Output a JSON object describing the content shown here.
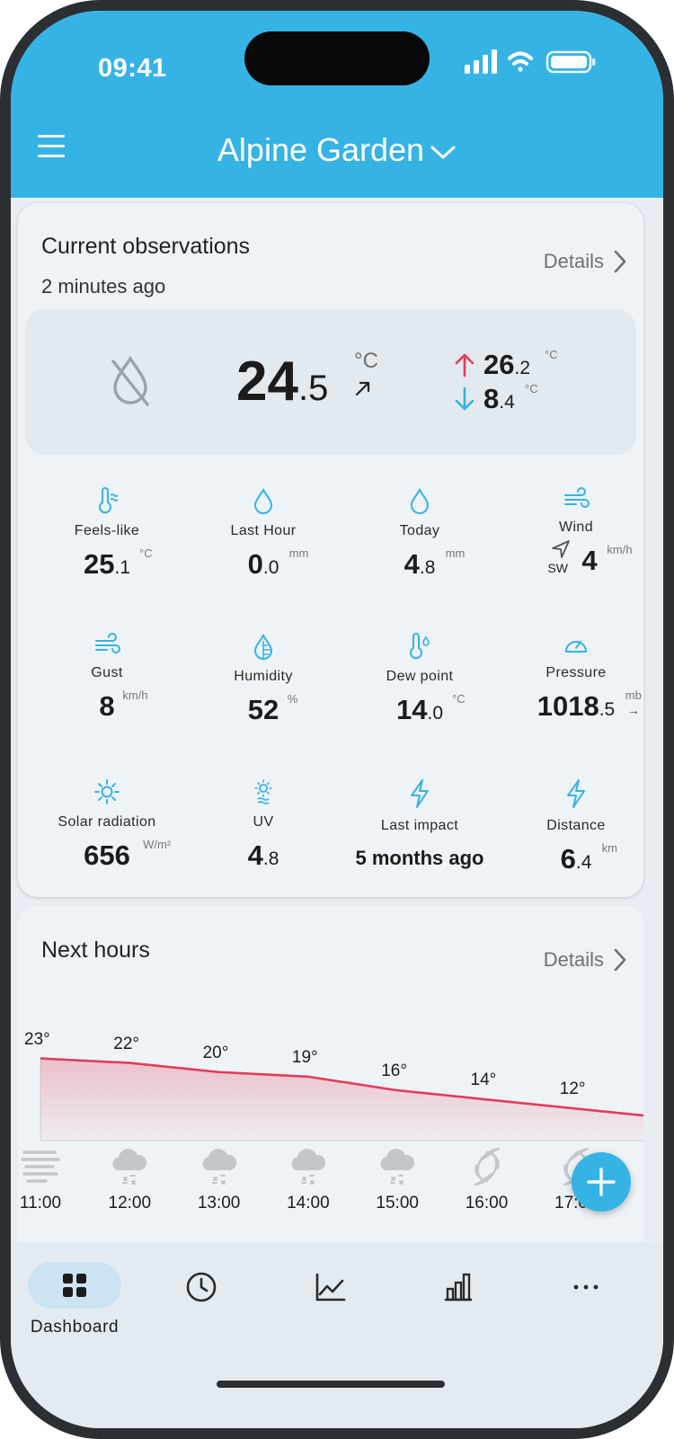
{
  "status_bar": {
    "time": "09:41"
  },
  "header": {
    "station_name": "Alpine Garden"
  },
  "current": {
    "title": "Current observations",
    "updated": "2 minutes ago",
    "details_label": "Details",
    "temperature": {
      "whole": "24",
      "decimal": ".5",
      "unit": "°C",
      "trend": "rising"
    },
    "high": {
      "whole": "26",
      "decimal": ".2",
      "unit": "°C"
    },
    "low": {
      "whole": "8",
      "decimal": ".4",
      "unit": "°C"
    },
    "metrics": [
      {
        "label": "Feels-like",
        "whole": "25",
        "decimal": ".1",
        "unit": "°C",
        "icon": "thermometer-wind-icon"
      },
      {
        "label": "Last Hour",
        "whole": "0",
        "decimal": ".0",
        "unit": "mm",
        "icon": "raindrop-icon"
      },
      {
        "label": "Today",
        "whole": "4",
        "decimal": ".8",
        "unit": "mm",
        "icon": "raindrop-icon"
      },
      {
        "label": "Wind",
        "whole": "4",
        "decimal": "",
        "unit": "km/h",
        "direction": "SW",
        "icon": "wind-icon"
      },
      {
        "label": "Gust",
        "whole": "8",
        "decimal": "",
        "unit": "km/h",
        "icon": "wind-icon"
      },
      {
        "label": "Humidity",
        "whole": "52",
        "decimal": "",
        "unit": "%",
        "icon": "humidity-icon"
      },
      {
        "label": "Dew point",
        "whole": "14",
        "decimal": ".0",
        "unit": "°C",
        "icon": "dew-point-icon"
      },
      {
        "label": "Pressure",
        "whole": "1018",
        "decimal": ".5",
        "unit": "mb",
        "icon": "gauge-icon"
      },
      {
        "label": "Solar radiation",
        "whole": "656",
        "decimal": "",
        "unit": "W/m²",
        "icon": "sun-icon"
      },
      {
        "label": "UV",
        "whole": "4",
        "decimal": ".8",
        "unit": "",
        "icon": "uv-icon"
      },
      {
        "label": "Last impact",
        "whole": "5 months ago",
        "decimal": "",
        "unit": "",
        "icon": "lightning-icon"
      },
      {
        "label": "Distance",
        "whole": "6",
        "decimal": ".4",
        "unit": "km",
        "icon": "lightning-icon"
      }
    ]
  },
  "forecast": {
    "title": "Next hours",
    "details_label": "Details",
    "temps": [
      "23°",
      "22°",
      "20°",
      "19°",
      "16°",
      "14°",
      "12°"
    ],
    "hours": [
      "11:00",
      "12:00",
      "13:00",
      "14:00",
      "15:00",
      "16:00",
      "17:00"
    ],
    "conditions": [
      "fog",
      "snow",
      "snow",
      "snow",
      "snow",
      "hurricane",
      "hurricane"
    ]
  },
  "chart_data": {
    "type": "line",
    "x": [
      "11:00",
      "12:00",
      "13:00",
      "14:00",
      "15:00",
      "16:00",
      "17:00"
    ],
    "series": [
      {
        "values": [
          23,
          22,
          20,
          19,
          16,
          14,
          12
        ]
      }
    ],
    "color": "#e23d5a"
  },
  "bottom_nav": {
    "items": [
      {
        "label": "Dashboard",
        "icon": "dashboard-grid-icon",
        "active": true
      },
      {
        "label": "",
        "icon": "clock-icon"
      },
      {
        "label": "",
        "icon": "line-chart-icon"
      },
      {
        "label": "",
        "icon": "bar-chart-icon"
      },
      {
        "label": "",
        "icon": "more-dots-icon"
      }
    ]
  },
  "colors": {
    "accent": "#35b3e5",
    "high": "#e23d5a",
    "low": "#35b3e5",
    "icon": "#35b3e5"
  }
}
